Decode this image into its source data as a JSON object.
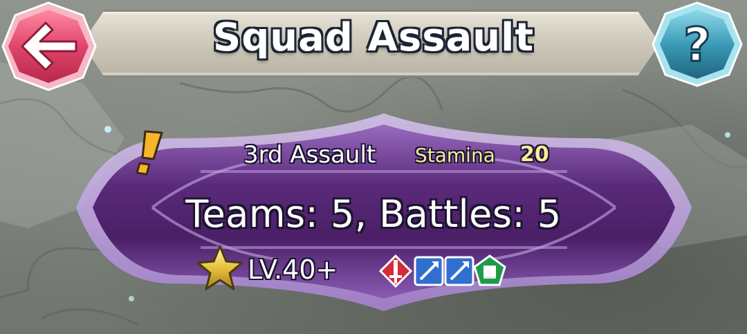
{
  "header": {
    "title": "Squad Assault",
    "back_icon": "arrow-left-icon",
    "help_icon": "question-mark-icon"
  },
  "event": {
    "assault_name": "3rd Assault",
    "stamina_label": "Stamina",
    "stamina_value": "20",
    "summary": "Teams: 5, Battles: 5",
    "level": "LV.40+",
    "new_badge_icon": "exclamation-icon",
    "difficulty_icon": "star-icon",
    "weapon_icons": [
      "sword-red-icon",
      "lance-blue-icon",
      "lance-blue-icon",
      "tome-green-icon"
    ]
  },
  "colors": {
    "back_button": "#e0456a",
    "help_button": "#3b9bb8",
    "banner": "#5a2a7a",
    "stamina_text": "#f4ec9a"
  }
}
